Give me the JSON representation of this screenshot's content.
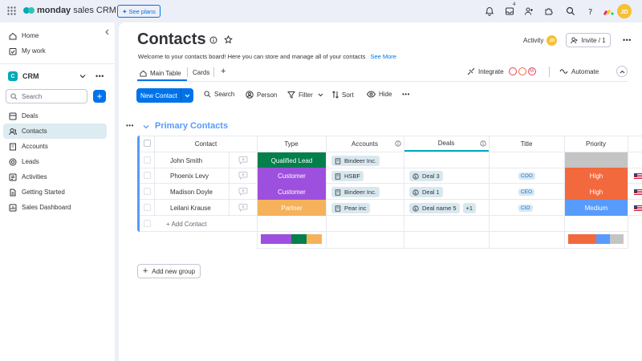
{
  "topbar": {
    "brand": "monday",
    "product": "sales CRM",
    "see_plans": "See plans",
    "notification_count": "4",
    "avatar_initials": "JD"
  },
  "sidebar": {
    "home": "Home",
    "my_work": "My work",
    "workspace_badge": "C",
    "workspace_name": "CRM",
    "search_placeholder": "Search",
    "items": [
      {
        "label": "Deals",
        "icon": "board-icon"
      },
      {
        "label": "Contacts",
        "icon": "person-icon"
      },
      {
        "label": "Accounts",
        "icon": "building-icon"
      },
      {
        "label": "Leads",
        "icon": "target-icon"
      },
      {
        "label": "Activities",
        "icon": "list-icon"
      },
      {
        "label": "Getting Started",
        "icon": "doc-icon"
      },
      {
        "label": "Sales Dashboard",
        "icon": "dashboard-icon"
      }
    ]
  },
  "board": {
    "title": "Contacts",
    "description": "Welcome to your contacts board! Here you can store and manage all of your contacts",
    "see_more": "See More",
    "activity": "Activity",
    "activity_avatar": "JD",
    "invite": "Invite / 1",
    "tabs": [
      "Main Table",
      "Cards"
    ],
    "integrate": "Integrate",
    "automate": "Automate"
  },
  "toolbar": {
    "new_item": "New Contact",
    "search": "Search",
    "person": "Person",
    "filter": "Filter",
    "sort": "Sort",
    "hide": "Hide"
  },
  "group": {
    "title": "Primary Contacts",
    "color": "#579bfc",
    "columns": [
      "Contact",
      "Type",
      "Accounts",
      "Deals",
      "Title",
      "Priority"
    ],
    "rows": [
      {
        "contact": "John Smith",
        "type": "Qualified Lead",
        "type_color": "#037f4c",
        "account": "Bindeer Inc.",
        "deals": [],
        "title": "",
        "priority": "",
        "priority_color": "#c4c4c4"
      },
      {
        "contact": "Phoenix Levy",
        "type": "Customer",
        "type_color": "#9d50dd",
        "account": "HSBF",
        "deals": [
          "Deal 3"
        ],
        "title": "COO",
        "priority": "High",
        "priority_color": "#f2693e"
      },
      {
        "contact": "Madison Doyle",
        "type": "Customer",
        "type_color": "#9d50dd",
        "account": "Bindeer Inc.",
        "deals": [
          "Deal 1"
        ],
        "title": "CEO",
        "priority": "High",
        "priority_color": "#f2693e"
      },
      {
        "contact": "Leilani Krause",
        "type": "Partner",
        "type_color": "#f5b25a",
        "account": "Pear inc",
        "deals": [
          "Deal name 5"
        ],
        "deals_more": "+1",
        "title": "CIO",
        "priority": "Medium",
        "priority_color": "#579bfc"
      }
    ],
    "add_row": "+ Add Contact",
    "summary_type_colors": [
      "#9d50dd",
      "#9d50dd",
      "#037f4c",
      "#f5b25a"
    ],
    "summary_priority_colors": [
      "#f2693e",
      "#f2693e",
      "#579bfc",
      "#c4c4c4"
    ]
  },
  "add_group": "Add new group"
}
